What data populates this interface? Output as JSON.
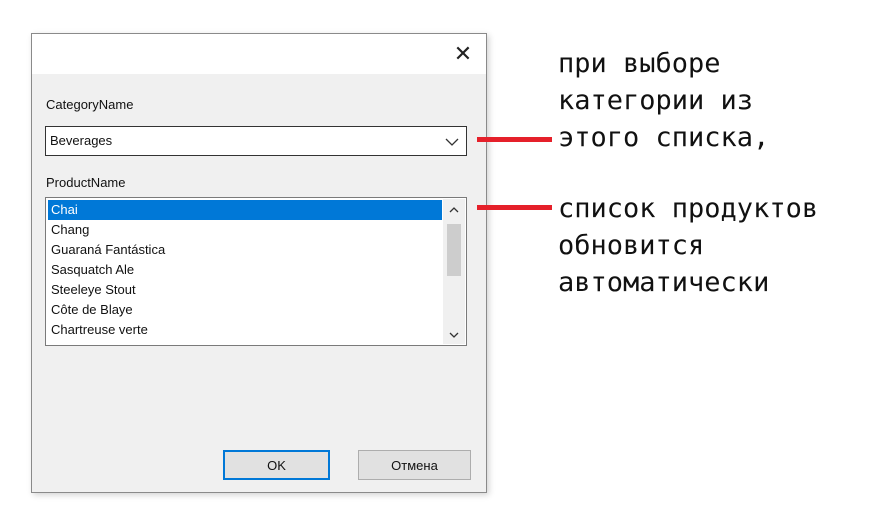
{
  "dialog": {
    "close_glyph": "✕",
    "category_label": "CategoryName",
    "category_value": "Beverages",
    "product_label": "ProductName",
    "products": [
      "Chai",
      "Chang",
      "Guaraná Fantástica",
      "Sasquatch Ale",
      "Steeleye Stout",
      "Côte de Blaye",
      "Chartreuse verte"
    ],
    "selected_product_index": 0,
    "ok_label": "OK",
    "cancel_label": "Отмена"
  },
  "annotation": {
    "lines_top": [
      "при выборе",
      "категории из",
      "этого списка,"
    ],
    "lines_bottom": [
      "список продуктов",
      "обновится",
      "автоматически"
    ]
  },
  "colors": {
    "selection": "#0078d7",
    "arrow": "#e5202a"
  },
  "icons": {
    "close": "close-icon",
    "combo_arrow": "chevron-down-icon",
    "scroll_up": "chevron-up-icon",
    "scroll_down": "chevron-down-icon"
  }
}
